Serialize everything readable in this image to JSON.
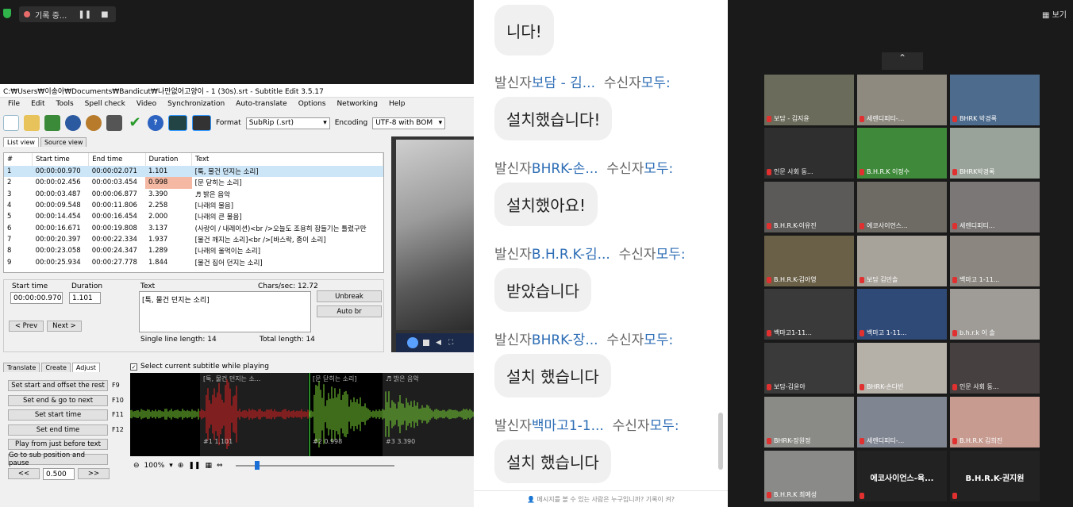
{
  "topbar": {
    "rec_label": "기록 중...",
    "view_label": "보기"
  },
  "se": {
    "title": "C:₩Users₩이송아₩Documents₩Bandicut₩나만없어고양이 - 1 (30s).srt - Subtitle Edit 3.5.17",
    "menu": [
      "File",
      "Edit",
      "Tools",
      "Spell check",
      "Video",
      "Synchronization",
      "Auto-translate",
      "Options",
      "Networking",
      "Help"
    ],
    "format_label": "Format",
    "format_value": "SubRip (.srt)",
    "encoding_label": "Encoding",
    "encoding_value": "UTF-8 with BOM",
    "tabs": [
      "List view",
      "Source view"
    ],
    "columns": [
      "#",
      "Start time",
      "End time",
      "Duration",
      "Text"
    ],
    "rows": [
      [
        "1",
        "00:00:00.970",
        "00:00:02.071",
        "1.101",
        "[툭, 물건 던지는 소리]"
      ],
      [
        "2",
        "00:00:02.456",
        "00:00:03.454",
        "0.998",
        "[문 닫히는 소리]"
      ],
      [
        "3",
        "00:00:03.487",
        "00:00:06.877",
        "3.390",
        "♬ 밝은 음악"
      ],
      [
        "4",
        "00:00:09.548",
        "00:00:11.806",
        "2.258",
        "[나래의 물음]"
      ],
      [
        "5",
        "00:00:14.454",
        "00:00:16.454",
        "2.000",
        "[나래의 큰 물음]"
      ],
      [
        "6",
        "00:00:16.671",
        "00:00:19.808",
        "3.137",
        "(사랑이 / 내레이션)<br />오늘도 조용히 잠들기는 틀렸구만"
      ],
      [
        "7",
        "00:00:20.397",
        "00:00:22.334",
        "1.937",
        "[물건 깨지는 소리]<br />[바스락, 종이 소리]"
      ],
      [
        "8",
        "00:00:23.058",
        "00:00:24.347",
        "1.289",
        "[나래의 울먹이는 소리]"
      ],
      [
        "9",
        "00:00:25.934",
        "00:00:27.778",
        "1.844",
        "[물건 집어 던지는 소리]"
      ]
    ],
    "edit": {
      "start_label": "Start time",
      "start_value": "00:00:00.970",
      "dur_label": "Duration",
      "dur_value": "1.101",
      "text_label": "Text",
      "chars": "Chars/sec: 12.72",
      "text_value": "[툭, 물건 던지는 소리]",
      "single": "Single line length: 14",
      "total": "Total length: 14",
      "unbreak": "Unbreak",
      "autobr": "Auto br",
      "prev": "< Prev",
      "next": "Next >"
    },
    "bottom_tabs": [
      "Translate",
      "Create",
      "Adjust"
    ],
    "checkbox": "Select current subtitle while playing",
    "adjust_buttons": [
      {
        "label": "Set start and offset the rest",
        "key": "F9"
      },
      {
        "label": "Set end & go to next",
        "key": "F10"
      },
      {
        "label": "Set start time",
        "key": "F11"
      },
      {
        "label": "Set end time",
        "key": "F12"
      },
      {
        "label": "Play from just before text",
        "key": ""
      },
      {
        "label": "Go to sub position and pause",
        "key": ""
      }
    ],
    "step": {
      "back": "<<",
      "value": "0.500",
      "fwd": ">>"
    },
    "wave_labels": [
      "[툭, 물건 던지는 소...",
      "[문 닫히는 소리]",
      "♬ 밝은 음악"
    ],
    "wave_nums": [
      "#1  1.101",
      "#2  0.998",
      "#3  3.390"
    ],
    "zoom": "100%"
  },
  "chat": {
    "top_fragment": "니다!",
    "messages": [
      {
        "prefix": "발신자",
        "sender": "보담 - 김...",
        "to": "수신자",
        "rcpt": "모두:",
        "text": "설치했습니다!"
      },
      {
        "prefix": "발신자",
        "sender": "BHRK-손...",
        "to": "수신자",
        "rcpt": "모두:",
        "text": "설치했아요!"
      },
      {
        "prefix": "발신자",
        "sender": "B.H.R.K-김...",
        "to": "수신자",
        "rcpt": "모두:",
        "text": "받았습니다"
      },
      {
        "prefix": "발신자",
        "sender": "BHRK-장...",
        "to": "수신자",
        "rcpt": "모두:",
        "text": "설치 했습니다"
      },
      {
        "prefix": "발신자",
        "sender": "백마고1-1...",
        "to": "수신자",
        "rcpt": "모두:",
        "text": "설치 했습니다"
      }
    ],
    "footer": "메시지를 볼 수 있는 사람은 누구입니까? 기록이 켜?"
  },
  "participants": [
    "보담 - 김지윤",
    "세렌디피티-...",
    "BHRK 박경록",
    "인문 사회 동...",
    "B.H.R.K 이정수",
    "BHRK박경록",
    "B.H.R.K-이유진",
    "에코사이언스...",
    "세렌디피티...",
    "B.H.R.K-김아영",
    "보담 김민솔",
    "백마고 1-11...",
    "백마고1-11...",
    "백마고 1-11...",
    "b.h.r.k 이 솔",
    "보담-김윤아",
    "BHRK-손다빈",
    "인문 사회 동...",
    "BHRK-장원정",
    "세렌디피티-...",
    "B.H.R.K 김희진",
    "B.H.R.K 최예성",
    "에코사이언스-육...",
    "B.H.R.K-권지원"
  ]
}
